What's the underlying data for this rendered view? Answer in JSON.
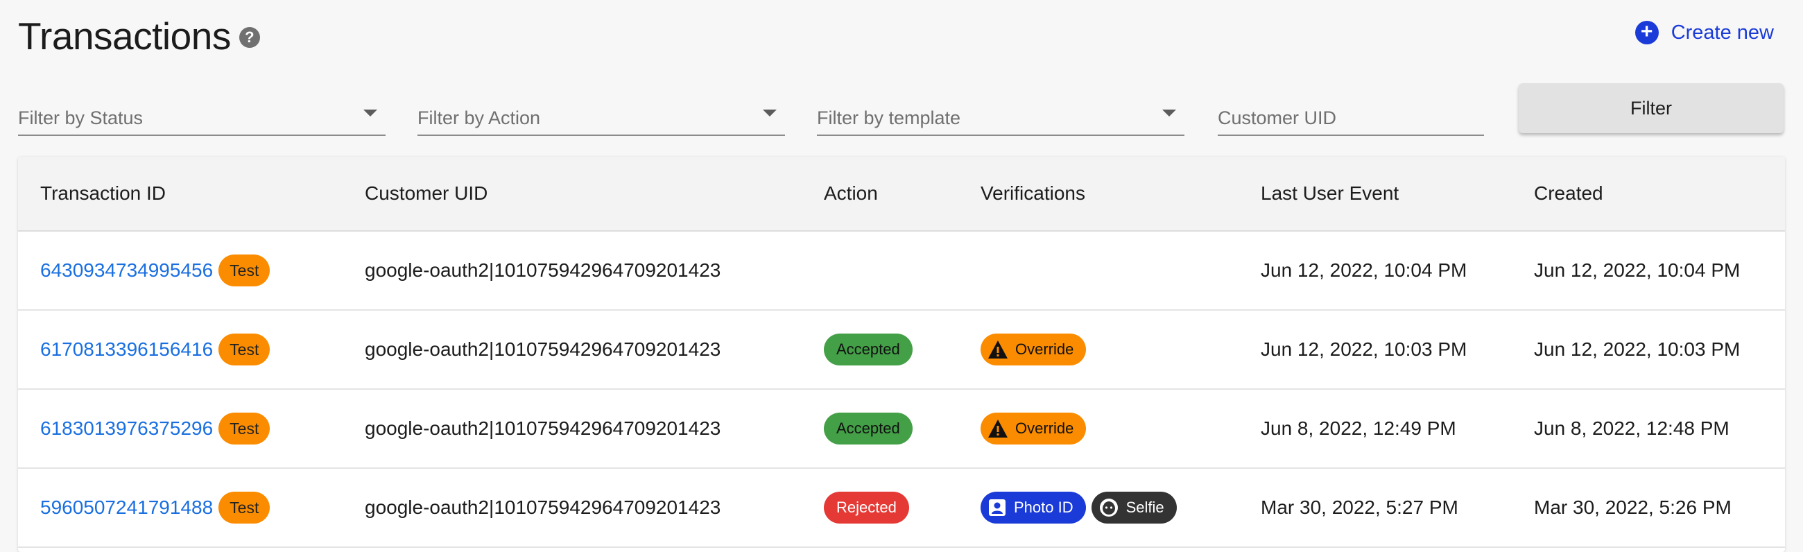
{
  "header": {
    "title": "Transactions",
    "help_icon": "help-circle-icon",
    "create_new_label": "Create new",
    "create_new_icon": "plus-circle-icon"
  },
  "filters": {
    "status_placeholder": "Filter by Status",
    "action_placeholder": "Filter by Action",
    "template_placeholder": "Filter by template",
    "customer_uid_placeholder": "Customer UID",
    "filter_button_label": "Filter"
  },
  "table": {
    "columns": [
      "Transaction ID",
      "Customer UID",
      "Action",
      "Verifications",
      "Last User Event",
      "Created"
    ],
    "rows": [
      {
        "transaction_id": "6430934734995456",
        "badge": "Test",
        "customer_uid": "google-oauth2|101075942964709201423",
        "action": "",
        "verifications": [],
        "last_user_event": "Jun 12, 2022, 10:04 PM",
        "created": "Jun 12, 2022, 10:04 PM"
      },
      {
        "transaction_id": "6170813396156416",
        "badge": "Test",
        "customer_uid": "google-oauth2|101075942964709201423",
        "action": "Accepted",
        "verifications": [
          {
            "label": "Override",
            "icon": "warning-icon"
          }
        ],
        "last_user_event": "Jun 12, 2022, 10:03 PM",
        "created": "Jun 12, 2022, 10:03 PM"
      },
      {
        "transaction_id": "6183013976375296",
        "badge": "Test",
        "customer_uid": "google-oauth2|101075942964709201423",
        "action": "Accepted",
        "verifications": [
          {
            "label": "Override",
            "icon": "warning-icon"
          }
        ],
        "last_user_event": "Jun 8, 2022, 12:49 PM",
        "created": "Jun 8, 2022, 12:48 PM"
      },
      {
        "transaction_id": "5960507241791488",
        "badge": "Test",
        "customer_uid": "google-oauth2|101075942964709201423",
        "action": "Rejected",
        "verifications": [
          {
            "label": "Photo ID",
            "icon": "id-card-icon"
          },
          {
            "label": "Selfie",
            "icon": "selfie-face-icon"
          }
        ],
        "last_user_event": "Mar 30, 2022, 5:27 PM",
        "created": "Mar 30, 2022, 5:26 PM"
      }
    ]
  },
  "colors": {
    "link": "#1a6fe0",
    "accent": "#1a3bd8",
    "test_badge": "#fb8c00",
    "accepted": "#43a047",
    "rejected": "#e53935",
    "override": "#fb8c00",
    "photo_id": "#1a3bd8",
    "selfie": "#333333"
  }
}
